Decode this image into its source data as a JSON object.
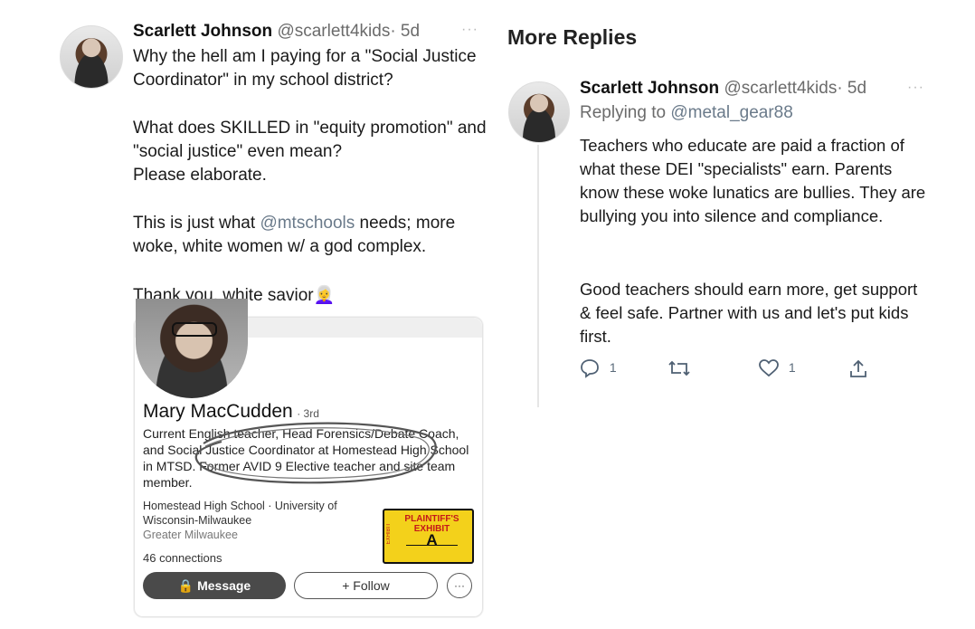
{
  "left_tweet": {
    "author_name": "Scarlett Johnson",
    "handle": "@scarlett4kids",
    "age": "· 5d",
    "more": "···",
    "para1": "Why the hell am I paying for a \"Social Justice Coordinator\" in my school district?",
    "para2": "What does SKILLED in \"equity promotion\" and \"social justice\" even mean?\nPlease elaborate.",
    "para3_pre": "This is just what ",
    "para3_mention": "@mtschools",
    "para3_post": " needs; more woke, white women w/ a god complex.",
    "para4": "Thank you, white savior",
    "emoji": "👩‍🦳"
  },
  "linkedin_card": {
    "name": "Mary MacCudden",
    "degree": "· 3rd",
    "headline": "Current English teacher, Head Forensics/Debate Coach, and Social Justice Coordinator at Homestead High School in MTSD. Former AVID 9 Elective teacher and site team member.",
    "org": "Homestead High School · University of Wisconsin-Milwaukee",
    "location": "Greater Milwaukee",
    "connections": "46 connections",
    "message_label": "Message",
    "follow_label": "+ Follow",
    "more_label": "···"
  },
  "exhibit_stamp": {
    "line1": "PLAINTIFF'S",
    "line2": "EXHIBIT",
    "letter": "A",
    "side": "EXHIBIT"
  },
  "more_replies": {
    "heading": "More Replies",
    "author_name": "Scarlett Johnson",
    "handle": "@scarlett4kids",
    "age": "· 5d",
    "more": "···",
    "replying_to_label": "Replying to ",
    "replying_to_handle": "@metal_gear88",
    "para1": "Teachers who educate are paid a fraction of what these DEI \"specialists\" earn. Parents know these woke lunatics are bullies. They are bullying you into silence and compliance.",
    "para2": "Good teachers should earn more, get support & feel safe. Partner with us and let's put kids first.",
    "reply_count": "1",
    "like_count": "1"
  },
  "colors": {
    "accent": "#5a6a7a",
    "stamp_yellow": "#f3d11b",
    "message_button": "#4a4a4a"
  }
}
